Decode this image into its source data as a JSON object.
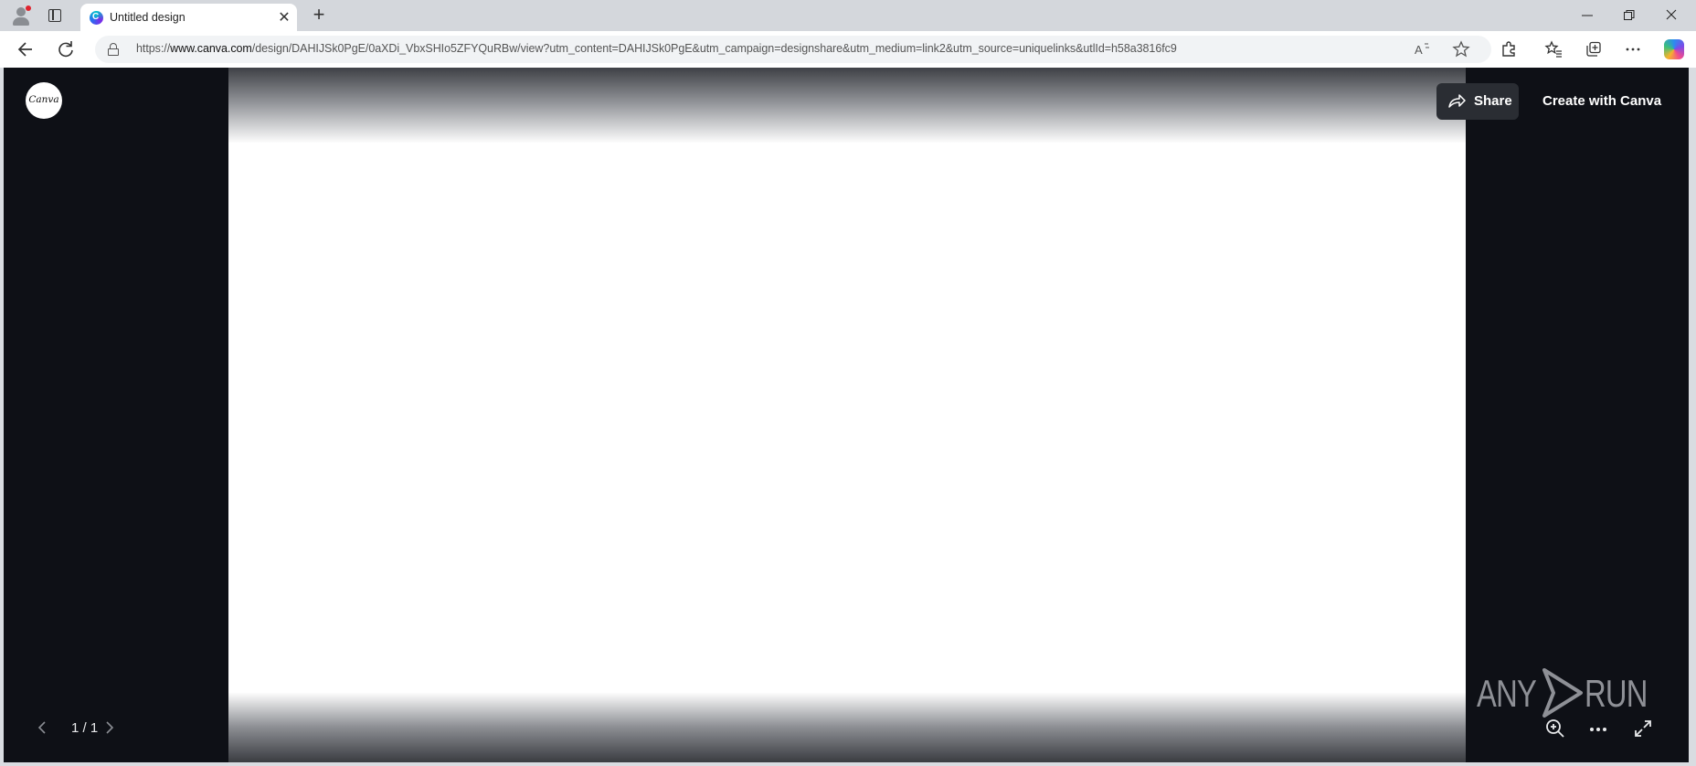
{
  "browser": {
    "tab_title": "Untitled design",
    "url_prefix": "https://",
    "url_host": "www.canva.com",
    "url_path": "/design/DAHIJSk0PgE/0aXDi_VbxSHIo5ZFYQuRBw/view?utm_content=DAHIJSk0PgE&utm_campaign=designshare&utm_medium=link2&utm_source=uniquelinks&utlId=h58a3816fc9",
    "new_tab_glyph": "+",
    "close_glyph": "✕",
    "accent_color": "#0078d4"
  },
  "viewer": {
    "logo_text": "Canva",
    "share_label": "Share",
    "create_label": "Create with Canva",
    "page_indicator": "1 / 1",
    "background_color": "#0e1016",
    "page_color": "#ffffff"
  },
  "watermark": {
    "text_left": "ANY",
    "text_right": "RUN"
  }
}
